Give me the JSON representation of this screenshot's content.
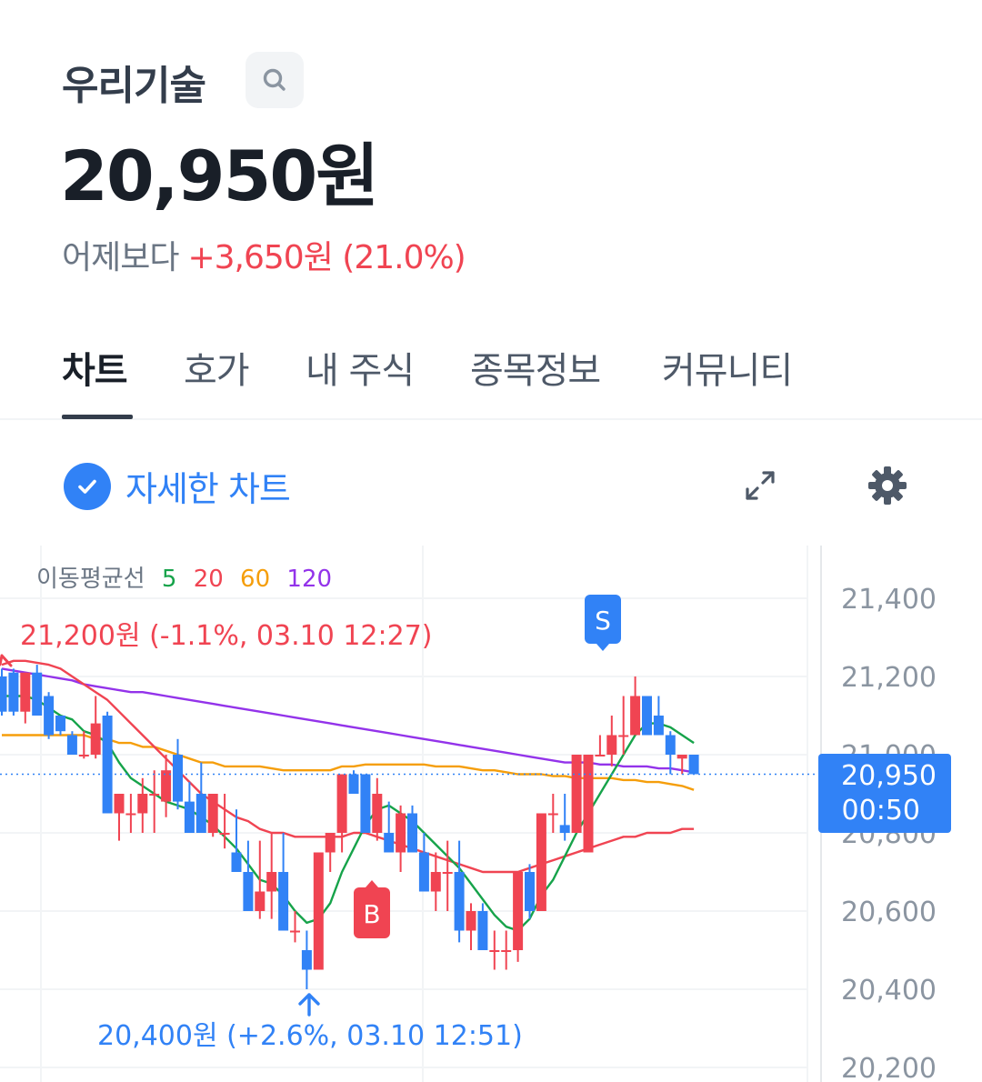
{
  "header": {
    "stock_name": "우리기술",
    "search_icon": "search-icon",
    "price": "20,950원",
    "change_label": "어제보다",
    "change_value": "+3,650원 (21.0%)",
    "up_color": "#f04452"
  },
  "tabs": [
    {
      "label": "차트",
      "active": true
    },
    {
      "label": "호가",
      "active": false
    },
    {
      "label": "내 주식",
      "active": false
    },
    {
      "label": "종목정보",
      "active": false
    },
    {
      "label": "커뮤니티",
      "active": false
    }
  ],
  "chart_controls": {
    "detail_label": "자세한 차트",
    "detail_checked": true,
    "expand_icon": "expand-icon",
    "settings_icon": "gear-icon",
    "accent_color": "#3182f6"
  },
  "chart_data": {
    "type": "candlestick",
    "ma_legend": {
      "label": "이동평균선",
      "items": [
        {
          "period": "5",
          "color": "#16a34a"
        },
        {
          "period": "20",
          "color": "#f04452"
        },
        {
          "period": "60",
          "color": "#f59e0b"
        },
        {
          "period": "120",
          "color": "#9333ea"
        }
      ]
    },
    "y_ticks": [
      "21,400",
      "21,200",
      "21,000",
      "20,800",
      "20,600",
      "20,400",
      "20,200"
    ],
    "y_tick_values": [
      21400,
      21200,
      21000,
      20800,
      20600,
      20400,
      20200
    ],
    "current_price": {
      "value": 20950,
      "label": "20,950",
      "time": "00:50",
      "color": "#3182f6"
    },
    "high_annotation": {
      "text": "21,200원 (-1.1%, 03.10 12:27)",
      "value": 21200,
      "color": "#f04452"
    },
    "low_annotation": {
      "text": "20,400원 (+2.6%, 03.10 12:51)",
      "value": 20400,
      "color": "#3182f6"
    },
    "markers": [
      {
        "label": "S",
        "color": "#3182f6"
      },
      {
        "label": "B",
        "color": "#f04452"
      }
    ],
    "up_color": "#f04452",
    "down_color": "#3182f6",
    "candles": [
      [
        21200,
        21220,
        21100,
        21110
      ],
      [
        21210,
        21220,
        21100,
        21110
      ],
      [
        21110,
        21210,
        21080,
        21210
      ],
      [
        21210,
        21230,
        21100,
        21100
      ],
      [
        21150,
        21160,
        21040,
        21050
      ],
      [
        21100,
        21100,
        21050,
        21060
      ],
      [
        21050,
        21060,
        21000,
        21000
      ],
      [
        21000,
        21060,
        20990,
        21000
      ],
      [
        21000,
        21150,
        20990,
        21080
      ],
      [
        21100,
        21110,
        20850,
        20850
      ],
      [
        20850,
        20900,
        20780,
        20900
      ],
      [
        20850,
        20900,
        20800,
        20850
      ],
      [
        20850,
        20940,
        20800,
        20900
      ],
      [
        20900,
        20960,
        20800,
        20900
      ],
      [
        20880,
        21000,
        20840,
        20960
      ],
      [
        21000,
        21040,
        20860,
        20880
      ],
      [
        20880,
        20930,
        20800,
        20800
      ],
      [
        20900,
        20980,
        20800,
        20800
      ],
      [
        20800,
        20900,
        20790,
        20900
      ],
      [
        20800,
        20900,
        20760,
        20800
      ],
      [
        20750,
        20860,
        20700,
        20700
      ],
      [
        20700,
        20780,
        20600,
        20600
      ],
      [
        20600,
        20780,
        20580,
        20650
      ],
      [
        20650,
        20800,
        20580,
        20700
      ],
      [
        20700,
        20800,
        20550,
        20550
      ],
      [
        20550,
        20600,
        20520,
        20550
      ],
      [
        20500,
        20550,
        20400,
        20450
      ],
      [
        20450,
        20750,
        20450,
        20750
      ],
      [
        20750,
        20800,
        20700,
        20800
      ],
      [
        20800,
        20950,
        20750,
        20950
      ],
      [
        20950,
        20960,
        20900,
        20900
      ],
      [
        20950,
        20950,
        20800,
        20800
      ],
      [
        20800,
        20940,
        20780,
        20900
      ],
      [
        20800,
        20880,
        20750,
        20750
      ],
      [
        20750,
        20870,
        20700,
        20850
      ],
      [
        20850,
        20870,
        20750,
        20750
      ],
      [
        20750,
        20800,
        20650,
        20650
      ],
      [
        20650,
        20750,
        20600,
        20700
      ],
      [
        20700,
        20780,
        20600,
        20700
      ],
      [
        20700,
        20780,
        20520,
        20550
      ],
      [
        20550,
        20620,
        20500,
        20600
      ],
      [
        20600,
        20620,
        20500,
        20500
      ],
      [
        20500,
        20550,
        20450,
        20500
      ],
      [
        20500,
        20550,
        20450,
        20500
      ],
      [
        20500,
        20700,
        20470,
        20700
      ],
      [
        20700,
        20720,
        20580,
        20600
      ],
      [
        20600,
        20850,
        20600,
        20850
      ],
      [
        20850,
        20900,
        20800,
        20850
      ],
      [
        20820,
        20900,
        20780,
        20800
      ],
      [
        20800,
        21000,
        20800,
        21000
      ],
      [
        20750,
        21000,
        20750,
        21000
      ],
      [
        21000,
        21050,
        21000,
        21000
      ],
      [
        21000,
        21100,
        20970,
        21050
      ],
      [
        21050,
        21150,
        21000,
        21050
      ],
      [
        21050,
        21200,
        21050,
        21150
      ],
      [
        21150,
        21150,
        21050,
        21050
      ],
      [
        21100,
        21150,
        21050,
        21050
      ],
      [
        21050,
        21060,
        20950,
        21000
      ],
      [
        20990,
        21000,
        20950,
        21000
      ],
      [
        21000,
        21000,
        20950,
        20950
      ]
    ],
    "ma5": [
      21150,
      21150,
      21150,
      21140,
      21120,
      21100,
      21090,
      21060,
      21050,
      21030,
      20980,
      20940,
      20920,
      20900,
      20880,
      20870,
      20860,
      20840,
      20820,
      20790,
      20760,
      20720,
      20680,
      20670,
      20640,
      20600,
      20570,
      20580,
      20620,
      20700,
      20760,
      20820,
      20860,
      20870,
      20850,
      20830,
      20800,
      20770,
      20740,
      20710,
      20670,
      20630,
      20590,
      20560,
      20550,
      20580,
      20640,
      20680,
      20740,
      20800,
      20850,
      20900,
      20950,
      21000,
      21050,
      21080,
      21080,
      21070,
      21050,
      21030
    ],
    "ma20": [
      21230,
      21240,
      21240,
      21235,
      21230,
      21220,
      21200,
      21180,
      21160,
      21140,
      21110,
      21080,
      21050,
      21020,
      20990,
      20960,
      20930,
      20900,
      20880,
      20860,
      20840,
      20830,
      20810,
      20800,
      20800,
      20790,
      20790,
      20790,
      20790,
      20790,
      20800,
      20800,
      20790,
      20780,
      20770,
      20760,
      20750,
      20740,
      20730,
      20720,
      20710,
      20700,
      20700,
      20700,
      20700,
      20710,
      20720,
      20730,
      20740,
      20750,
      20760,
      20770,
      20780,
      20790,
      20790,
      20800,
      20800,
      20800,
      20810,
      20810
    ],
    "ma60": [
      21050,
      21050,
      21050,
      21050,
      21050,
      21050,
      21050,
      21050,
      21040,
      21040,
      21030,
      21030,
      21020,
      21020,
      21010,
      21000,
      20990,
      20980,
      20980,
      20970,
      20970,
      20970,
      20970,
      20965,
      20960,
      20960,
      20960,
      20960,
      20960,
      20970,
      20970,
      20975,
      20975,
      20975,
      20975,
      20975,
      20975,
      20970,
      20970,
      20970,
      20965,
      20960,
      20960,
      20955,
      20950,
      20950,
      20950,
      20945,
      20945,
      20940,
      20940,
      20940,
      20940,
      20935,
      20935,
      20930,
      20930,
      20925,
      20920,
      20910
    ],
    "ma120": [
      21220,
      21215,
      21210,
      21205,
      21200,
      21195,
      21190,
      21180,
      21175,
      21170,
      21165,
      21160,
      21160,
      21155,
      21150,
      21145,
      21140,
      21135,
      21130,
      21125,
      21120,
      21115,
      21110,
      21105,
      21100,
      21095,
      21090,
      21085,
      21080,
      21075,
      21070,
      21065,
      21060,
      21055,
      21050,
      21045,
      21040,
      21035,
      21030,
      21025,
      21020,
      21015,
      21010,
      21005,
      21000,
      20995,
      20990,
      20985,
      20980,
      20980,
      20980,
      20975,
      20975,
      20970,
      20970,
      20970,
      20965,
      20965,
      20960,
      20955
    ]
  }
}
